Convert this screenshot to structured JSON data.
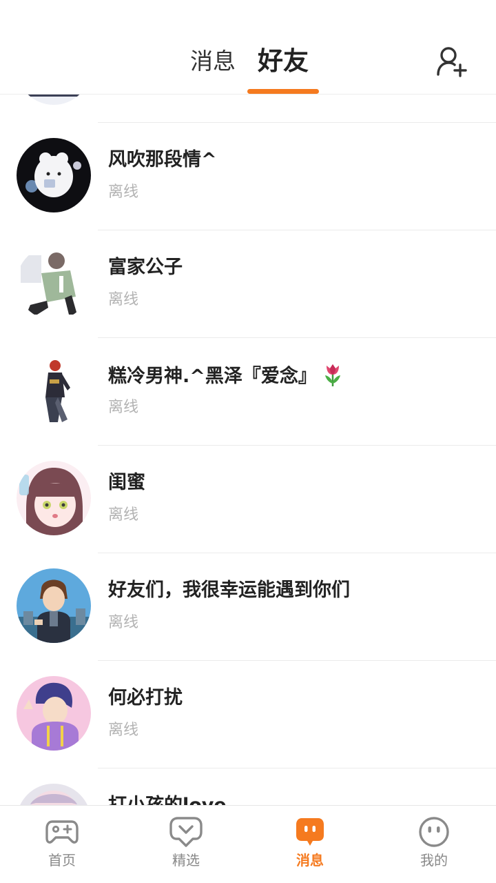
{
  "header": {
    "tabs": [
      {
        "label": "消息",
        "active": false
      },
      {
        "label": "好友",
        "active": true
      }
    ],
    "add_friend_icon": "add-user-icon"
  },
  "friends": [
    {
      "name": "",
      "status": ""
    },
    {
      "name": "风吹那段情^",
      "status": "离线"
    },
    {
      "name": "富家公子",
      "status": "离线"
    },
    {
      "name": "糕冷男神.^黑泽『爱念』",
      "status": "离线",
      "emoji": "tulip"
    },
    {
      "name": "闺蜜",
      "status": "离线"
    },
    {
      "name": "好友们，我很幸运能遇到你们",
      "status": "离线"
    },
    {
      "name": "何必打扰",
      "status": "离线"
    },
    {
      "name": "打小孩的love",
      "status": ""
    }
  ],
  "bottom_nav": [
    {
      "label": "首页",
      "icon": "gamepad-icon",
      "active": false
    },
    {
      "label": "精选",
      "icon": "heart-chat-icon",
      "active": false
    },
    {
      "label": "消息",
      "icon": "chat-bubble-icon",
      "active": true
    },
    {
      "label": "我的",
      "icon": "smiley-face-icon",
      "active": false
    }
  ],
  "colors": {
    "accent": "#f57a1f",
    "text": "#222222",
    "muted": "#b3b3b3"
  }
}
